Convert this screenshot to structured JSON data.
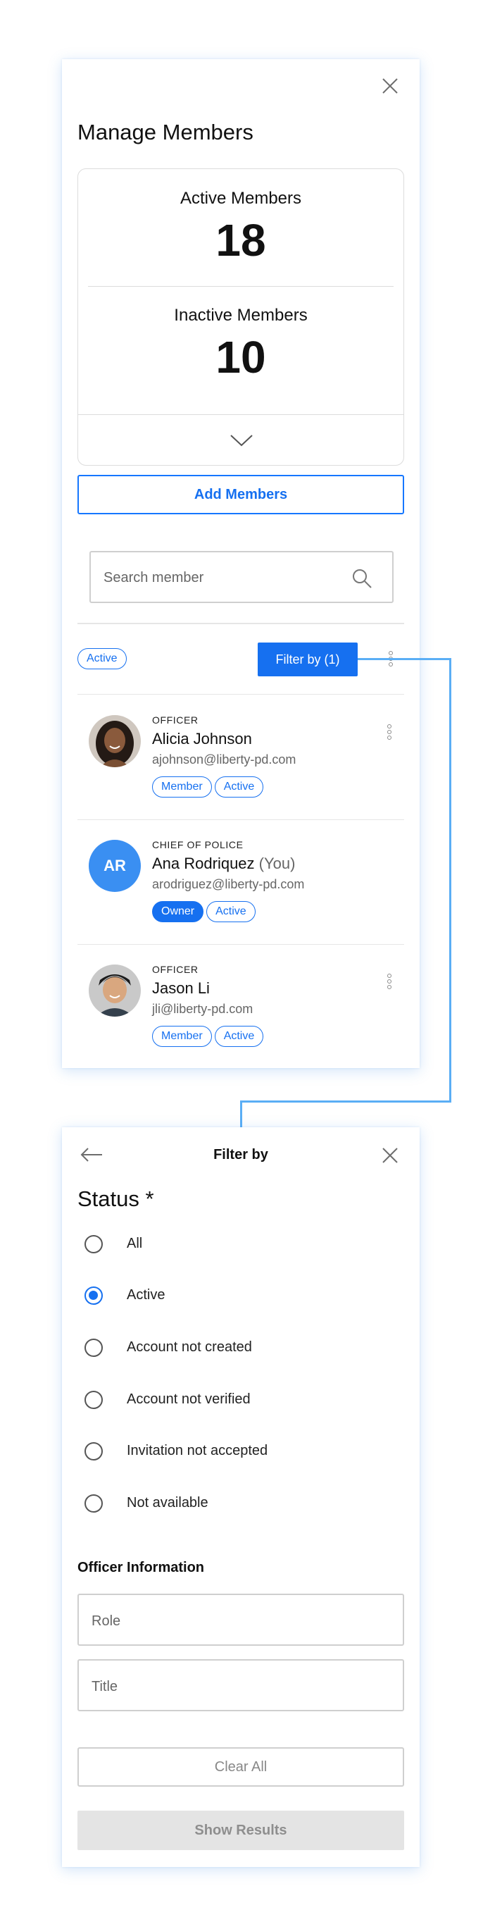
{
  "members_panel": {
    "title": "Manage Members",
    "stats": {
      "active_label": "Active Members",
      "active_value": "18",
      "inactive_label": "Inactive Members",
      "inactive_value": "10"
    },
    "add_button": "Add Members",
    "search": {
      "placeholder": "Search member"
    },
    "active_filter_chip": "Active",
    "filter_button": "Filter by (1)",
    "members": [
      {
        "role": "OFFICER",
        "name": "Alicia Johnson",
        "you": "",
        "email": "ajohnson@liberty-pd.com",
        "badges": [
          "Member",
          "Active"
        ],
        "avatar": "photo"
      },
      {
        "role": "CHIEF OF POLICE",
        "name": "Ana Rodriquez",
        "you": "(You)",
        "email": "arodriguez@liberty-pd.com",
        "badges": [
          "Owner",
          "Active"
        ],
        "avatar_initials": "AR"
      },
      {
        "role": "OFFICER",
        "name": "Jason Li",
        "you": "",
        "email": "jli@liberty-pd.com",
        "badges": [
          "Member",
          "Active"
        ],
        "avatar": "photo"
      }
    ]
  },
  "filter_panel": {
    "title": "Filter by",
    "status_title": "Status *",
    "status_options": [
      "All",
      "Active",
      "Account not created",
      "Account not verified",
      "Invitation not accepted",
      "Not available"
    ],
    "selected_status": "Active",
    "officer_section": "Officer Information",
    "role_placeholder": "Role",
    "title_placeholder": "Title",
    "clear_button": "Clear All",
    "show_button": "Show Results"
  },
  "colors": {
    "primary": "#1670f0",
    "initials_avatar": "#3a8ff2",
    "connector": "#5aaef5",
    "disabled_bg": "#e4e4e4"
  },
  "icons": [
    "close-icon",
    "chevron-down-icon",
    "search-icon",
    "kebab-menu-icon",
    "arrow-left-icon"
  ]
}
